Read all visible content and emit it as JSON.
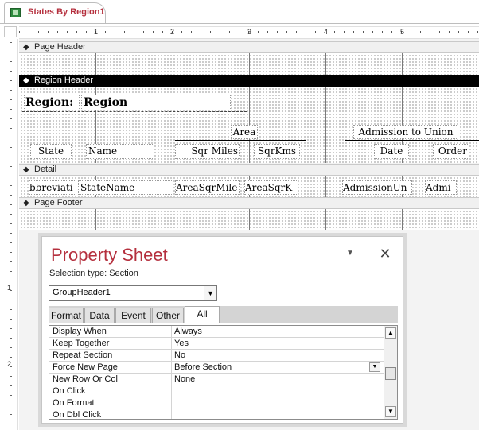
{
  "document_tab": {
    "title": "States By Region1",
    "icon": "report-icon"
  },
  "ruler": {
    "h_marks": [
      "1",
      "2",
      "3",
      "4",
      "5"
    ],
    "v_marks": [
      "1",
      "2"
    ]
  },
  "sections": {
    "page_header": "Page Header",
    "region_header": "Region Header",
    "detail": "Detail",
    "page_footer": "Page Footer"
  },
  "region_header": {
    "region_label": "Region:",
    "region_value": "Region",
    "area_heading": "Area",
    "admission_heading": "Admission to Union",
    "col_state": "State",
    "col_name": "Name",
    "col_sqr_miles": "Sqr Miles",
    "col_sqr_kms": "SqrKms",
    "col_date": "Date",
    "col_order": "Order"
  },
  "detail": {
    "f_abbrev": "bbreviati",
    "f_state_name": "StateName",
    "f_area_sqmiles": "AreaSqrMile",
    "f_area_sqkm": "AreaSqrK",
    "f_admission_date": "AdmissionUn",
    "f_admission_order": "Admi"
  },
  "property_sheet": {
    "title": "Property Sheet",
    "selection_type": "Selection type:  Section",
    "selected_object": "GroupHeader1",
    "tabs": [
      "Format",
      "Data",
      "Event",
      "Other",
      "All"
    ],
    "active_tab": "All",
    "rows": [
      {
        "name": "Display When",
        "value": "Always"
      },
      {
        "name": "Keep Together",
        "value": "Yes"
      },
      {
        "name": "Repeat Section",
        "value": "No"
      },
      {
        "name": "Force New Page",
        "value": "Before Section"
      },
      {
        "name": "New Row Or Col",
        "value": "None"
      },
      {
        "name": "On Click",
        "value": ""
      },
      {
        "name": "On Format",
        "value": ""
      },
      {
        "name": "On Dbl Click",
        "value": ""
      }
    ]
  }
}
